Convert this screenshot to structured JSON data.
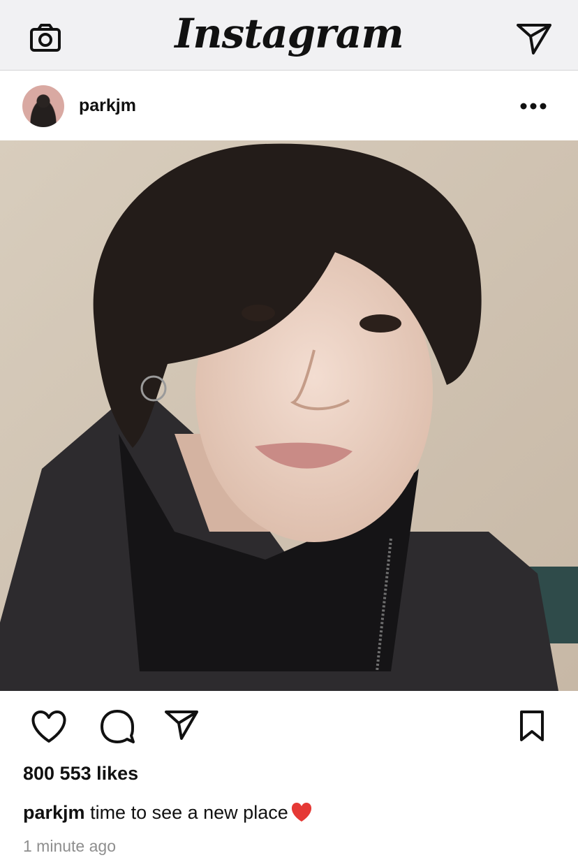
{
  "app": {
    "logo_text": "Instagram",
    "icons": {
      "left": "camera-icon",
      "right": "direct-message-icon"
    }
  },
  "post": {
    "username": "parkjm",
    "menu_icon": "more-options-icon",
    "likes": "800 553 likes",
    "caption": {
      "username": "parkjm",
      "text": "time to see a new place",
      "emoji": "red-heart-emoji"
    },
    "timestamp": "1 minute ago",
    "action_icons": [
      "heart-icon",
      "comment-icon",
      "share-icon",
      "bookmark-icon"
    ]
  },
  "colors": {
    "topbar_bg": "#f1f1f3",
    "text": "#111111",
    "muted": "#8e8e8e",
    "emoji_red": "#e53935"
  }
}
